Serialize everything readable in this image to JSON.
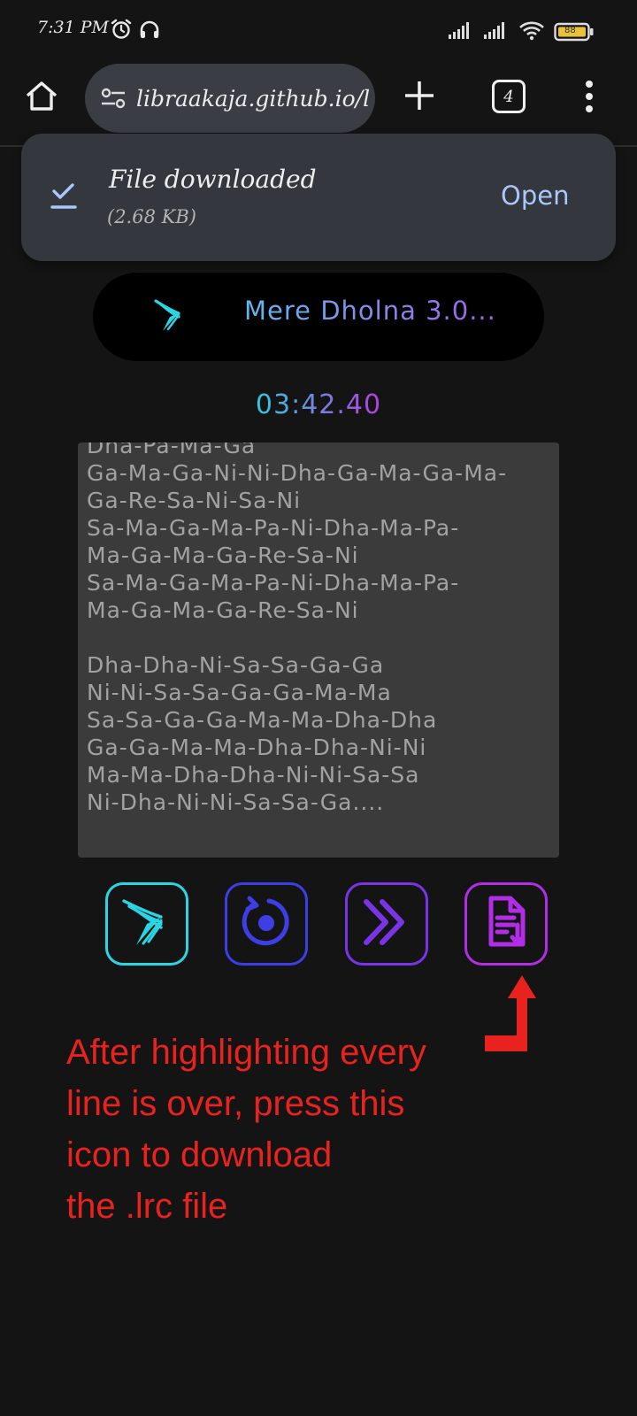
{
  "status_bar": {
    "time": "7:31 PM",
    "battery_level": "88",
    "icons": [
      "alarm-icon",
      "headphones-icon",
      "signal-icon",
      "signal-icon",
      "wifi-icon",
      "battery-icon"
    ]
  },
  "browser": {
    "url": "libraakaja.github.io/l",
    "tab_count": "4",
    "icons": [
      "home-icon",
      "site-settings-icon",
      "new-tab-icon",
      "tab-switcher-icon",
      "overflow-menu-icon"
    ]
  },
  "download_banner": {
    "title": "File downloaded",
    "size": "(2.68 KB)",
    "action": "Open",
    "accent": "#a8c7fa"
  },
  "player": {
    "song_title": "Mere Dholna 3.0...",
    "timer": "03:42.40",
    "lyrics": [
      "Dha-Pa-Ma-Ga",
      "Ga-Ma-Ga-Ni-Ni-Dha-Ga-Ma-Ga-Ma-",
      "Ga-Re-Sa-Ni-Sa-Ni",
      "Sa-Ma-Ga-Ma-Pa-Ni-Dha-Ma-Pa-",
      "Ma-Ga-Ma-Ga-Re-Sa-Ni",
      "Sa-Ma-Ga-Ma-Pa-Ni-Dha-Ma-Pa-",
      "Ma-Ga-Ma-Ga-Re-Sa-Ni",
      "",
      "Dha-Dha-Ni-Sa-Sa-Ga-Ga",
      "Ni-Ni-Sa-Sa-Ga-Ga-Ma-Ma",
      "Sa-Sa-Ga-Ga-Ma-Ma-Dha-Dha",
      "Ga-Ga-Ma-Ma-Dha-Dha-Ni-Ni",
      "Ma-Ma-Dha-Dha-Ni-Ni-Sa-Sa",
      "Ni-Dha-Ni-Ni-Sa-Sa-Ga...."
    ],
    "controls": [
      "logo-icon",
      "restart-icon",
      "next-icon",
      "download-lrc-icon"
    ],
    "colors": {
      "cyan": "#2ad6e3",
      "blue": "#3e3ee6",
      "violet": "#7a33e6",
      "purple": "#b12ee6"
    }
  },
  "annotation": {
    "lines": [
      "After highlighting every",
      "line is over, press this",
      "icon to download",
      "the .lrc file"
    ],
    "color": "#e8231f"
  }
}
